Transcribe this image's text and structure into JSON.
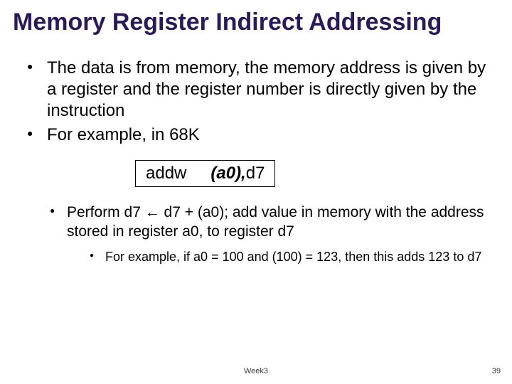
{
  "title": "Memory Register Indirect Addressing",
  "bullets": {
    "b0": "The data is from memory, the memory address is given by a register and the register number is directly given by the instruction",
    "b1": "For example, in 68K"
  },
  "code": {
    "mnemonic": "addw",
    "operand_italic": "(a0),",
    "operand_rest": "d7"
  },
  "sub": {
    "s0_pre": "Perform d7 ",
    "s0_arrow": "←",
    "s0_post": " d7 + (a0); add value in memory with the address stored in register a0, to register d7",
    "ss0": "For example, if a0 = 100 and (100) = 123, then this adds 123 to d7"
  },
  "footer": {
    "center": "Week3",
    "right": "39"
  }
}
